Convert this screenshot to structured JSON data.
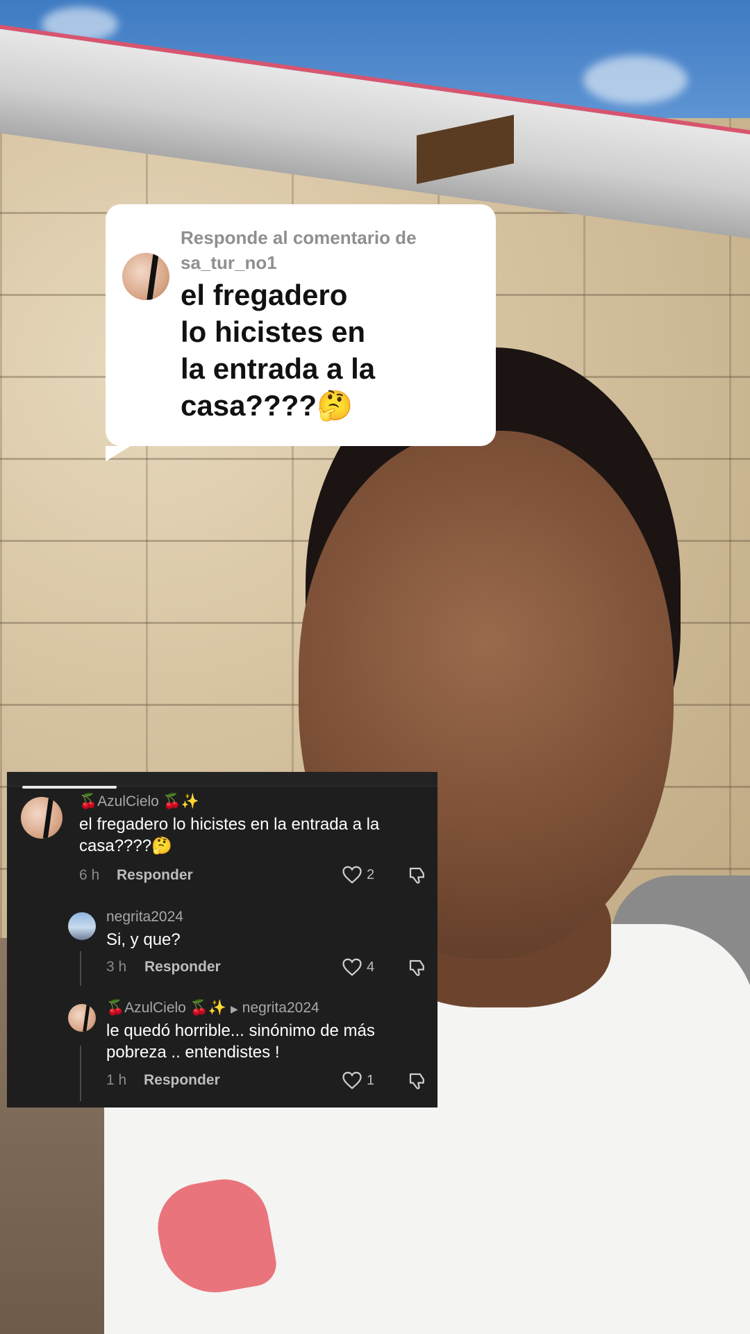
{
  "reply_sticker": {
    "header": "Responde al comentario de sa_tur_no1",
    "text": "el fregadero\nlo hicistes en\nla entrada a la\ncasa????🤔"
  },
  "comments": [
    {
      "user": "🍒AzulCielo 🍒✨",
      "text": "el fregadero lo hicistes en la entrada a la casa????🤔",
      "time": "6 h",
      "reply_label": "Responder",
      "likes": "2"
    },
    {
      "user": "negrita2024",
      "text": "Si, y que?",
      "time": "3 h",
      "reply_label": "Responder",
      "likes": "4"
    },
    {
      "user": "🍒AzulCielo 🍒✨",
      "reply_to": "negrita2024",
      "text": "le quedó horrible... sinónimo de más pobreza .. entendistes !",
      "time": "1 h",
      "reply_label": "Responder",
      "likes": "1"
    }
  ],
  "icons": {
    "like": "heart-outline-icon",
    "dislike": "thumbs-down-icon",
    "reply_arrow": "triangle-right-icon"
  },
  "colors": {
    "panel_bg": "#1e1e1e",
    "sticker_bg": "#ffffff",
    "muted_text": "#8c8c8c"
  }
}
